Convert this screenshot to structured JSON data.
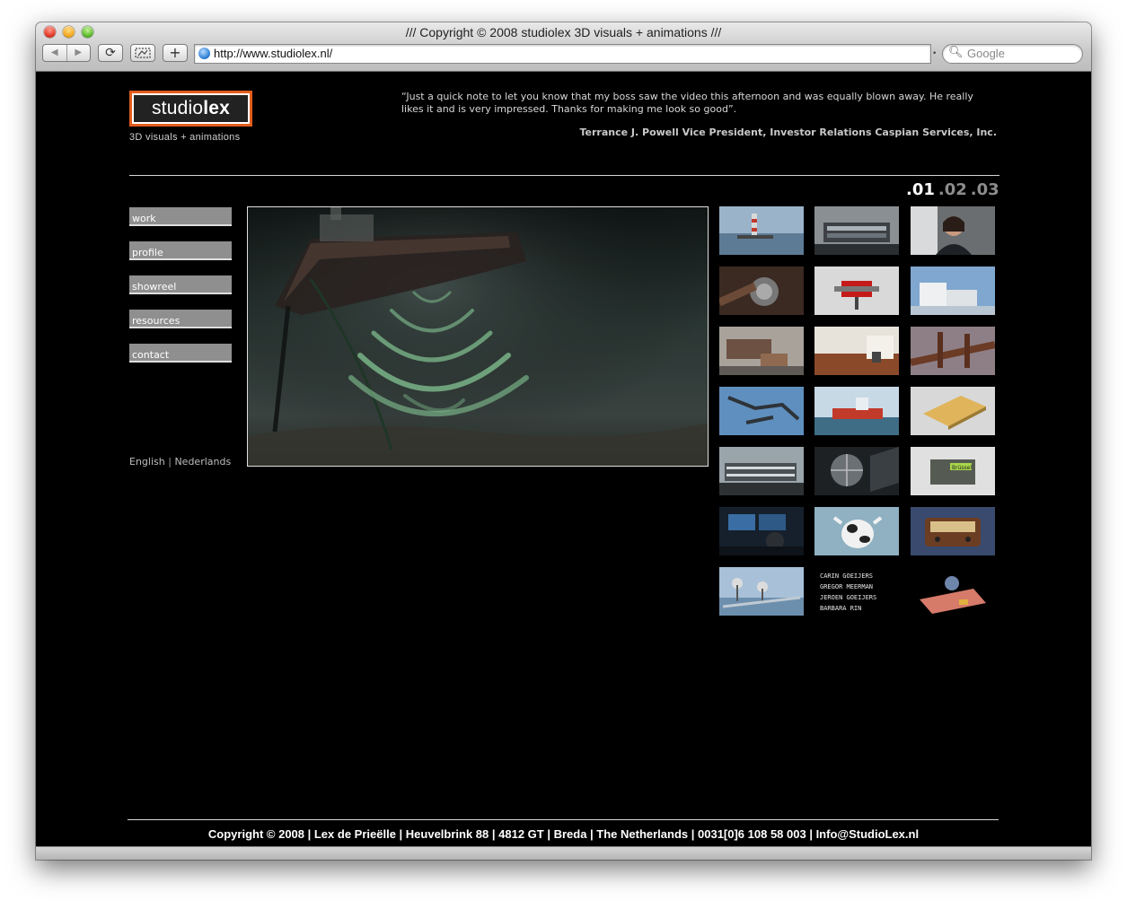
{
  "window": {
    "title": "/// Copyright © 2008 studiolex 3D visuals + animations ///",
    "url": "http://www.studiolex.nl/",
    "search_placeholder": "Google",
    "back_icon": "◀",
    "forward_icon": "▶",
    "reload_icon": "⟳",
    "add_tab_icon": "+"
  },
  "header": {
    "logo_light": "studio",
    "logo_bold": "lex",
    "tagline": "3D visuals + animations",
    "quote": "“Just a quick note to let you know that my boss saw the video this afternoon and was equally blown away.  He really likes it and is very impressed. Thanks for making me look so good”.",
    "quote_author": "Terrance J. Powell Vice President, Investor Relations Caspian Services, Inc."
  },
  "pager": [
    ".01",
    ".02",
    ".03"
  ],
  "menu": [
    "work",
    "profile",
    "showreel",
    "resources",
    "contact"
  ],
  "languages": {
    "english": "English",
    "separator": "|",
    "dutch": "Nederlands"
  },
  "thumb_texts": {
    "credits_1": "CARIN GOEIJERS",
    "credits_2": "GREGOR MEERMAN",
    "credits_3": "JEROEN GOEIJERS",
    "credits_4": "BARBARA RIN",
    "product_label": "Brüssel"
  },
  "footer": "Copyright © 2008 | Lex de Prieëlle | Heuvelbrink 88 | 4812 GT | Breda | The Netherlands | 0031[0]6 108 58 003 | Info@StudioLex.nl",
  "colors": {
    "accent": "#e35d1d",
    "menu_bg": "#8f8f8f",
    "background": "#000000"
  }
}
